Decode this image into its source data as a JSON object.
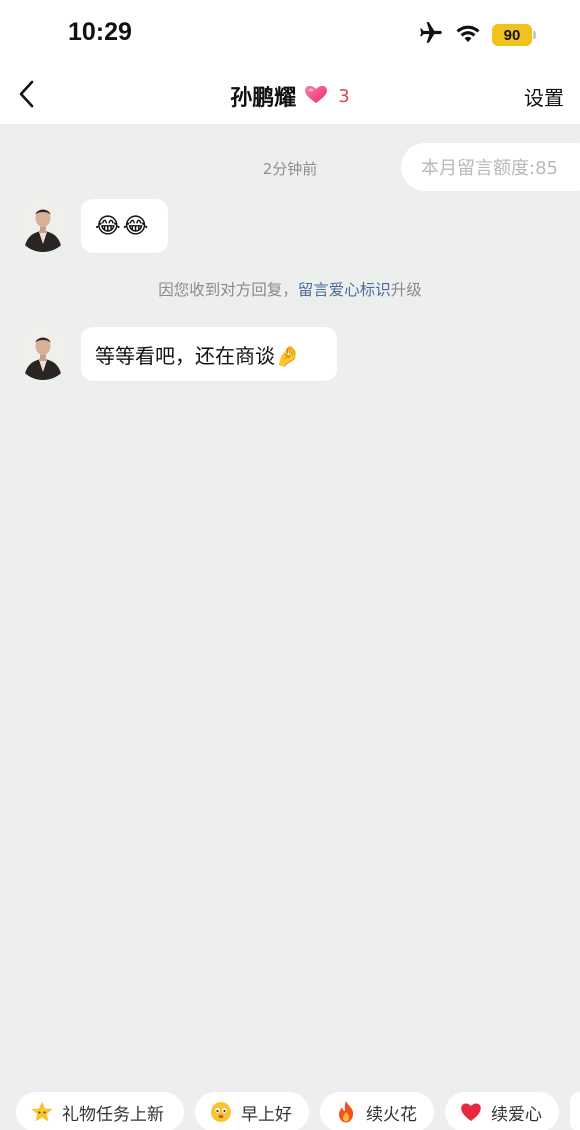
{
  "status_bar": {
    "time": "10:29",
    "battery": "90",
    "icons": [
      "airplane-icon",
      "wifi-icon",
      "battery-icon"
    ]
  },
  "nav": {
    "back_icon": "chevron-left-icon",
    "title": "孙鹏耀",
    "heart_count": "3",
    "settings_label": "设置"
  },
  "chat": {
    "quota_text": "本月留言额度:85",
    "timestamp": "2分钟前",
    "messages": [
      {
        "sender": "other",
        "content": "😂😂"
      },
      {
        "sender": "other",
        "content": "等等看吧，还在商谈🤌"
      }
    ],
    "system_message": {
      "prefix": "因您收到对方回复，",
      "link": "留言爱心标识",
      "suffix": "升级"
    }
  },
  "quick_replies": [
    {
      "label": "礼物任务上新",
      "icon": "star-face-icon"
    },
    {
      "label": "早上好",
      "icon": "sun-face-icon"
    },
    {
      "label": "续火花",
      "icon": "fire-icon"
    },
    {
      "label": "续爱心",
      "icon": "heart-icon"
    }
  ],
  "colors": {
    "background": "#edeeee",
    "link": "#4a6f9a",
    "heart": "#e0425a",
    "battery": "#f2c21c"
  }
}
